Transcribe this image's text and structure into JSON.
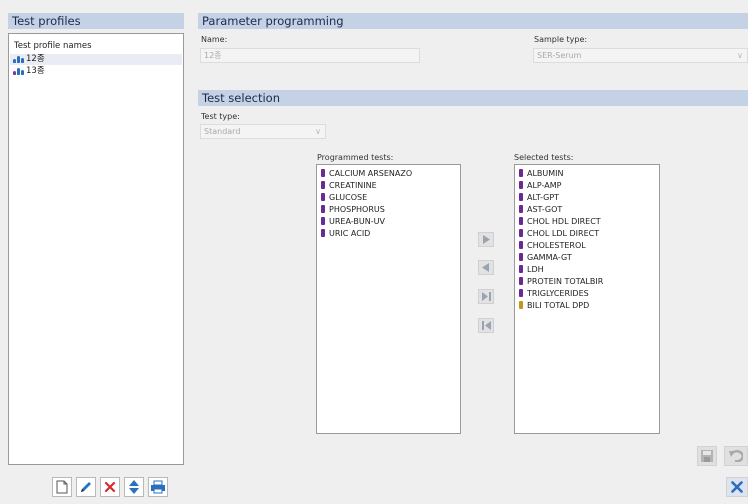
{
  "test_profiles": {
    "header": "Test profiles",
    "list_title": "Test profile names",
    "items": [
      {
        "label": "12종",
        "selected": true
      },
      {
        "label": "13종",
        "selected": false
      }
    ]
  },
  "parameter_programming": {
    "header": "Parameter programming",
    "name_label": "Name:",
    "name_value": "12종",
    "sample_type_label": "Sample type:",
    "sample_type_value": "SER-Serum"
  },
  "test_selection": {
    "header": "Test selection",
    "test_type_label": "Test type:",
    "test_type_value": "Standard",
    "programmed_label": "Programmed tests:",
    "selected_label": "Selected tests:",
    "programmed_tests": [
      "CALCIUM ARSENAZO",
      "CREATININE",
      "GLUCOSE",
      "PHOSPHORUS",
      "UREA-BUN-UV",
      "URIC ACID"
    ],
    "selected_tests": [
      {
        "label": "ALBUMIN",
        "color": "#6a2a91"
      },
      {
        "label": "ALP-AMP",
        "color": "#6a2a91"
      },
      {
        "label": "ALT-GPT",
        "color": "#6a2a91"
      },
      {
        "label": "AST-GOT",
        "color": "#6a2a91"
      },
      {
        "label": "CHOL HDL DIRECT",
        "color": "#6a2a91"
      },
      {
        "label": "CHOL LDL DIRECT",
        "color": "#6a2a91"
      },
      {
        "label": "CHOLESTEROL",
        "color": "#6a2a91"
      },
      {
        "label": "GAMMA-GT",
        "color": "#6a2a91"
      },
      {
        "label": "LDH",
        "color": "#6a2a91"
      },
      {
        "label": "PROTEIN TOTALBIR",
        "color": "#6a2a91"
      },
      {
        "label": "TRIGLYCERIDES",
        "color": "#6a2a91"
      },
      {
        "label": "BILI TOTAL DPD",
        "color": "#c4961c"
      }
    ]
  },
  "colors": {
    "header_bg": "#c5d2e6",
    "accent_blue": "#2a6fbf",
    "delete_red": "#d62b2b"
  }
}
